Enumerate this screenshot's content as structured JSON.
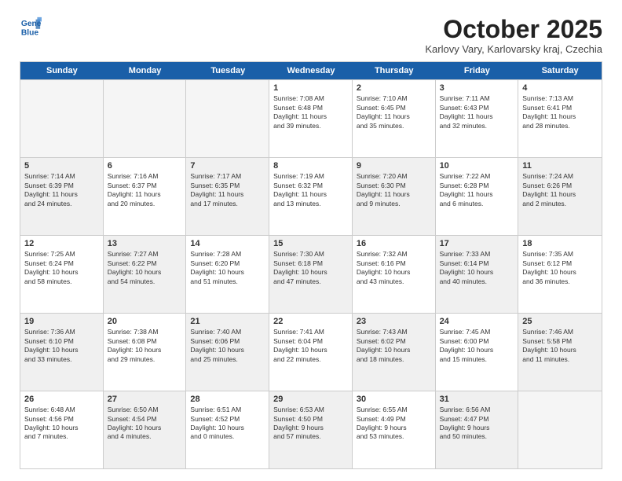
{
  "logo": {
    "line1": "General",
    "line2": "Blue"
  },
  "title": "October 2025",
  "subtitle": "Karlovy Vary, Karlovarsky kraj, Czechia",
  "header_days": [
    "Sunday",
    "Monday",
    "Tuesday",
    "Wednesday",
    "Thursday",
    "Friday",
    "Saturday"
  ],
  "rows": [
    [
      {
        "day": "",
        "text": "",
        "empty": true
      },
      {
        "day": "",
        "text": "",
        "empty": true
      },
      {
        "day": "",
        "text": "",
        "empty": true
      },
      {
        "day": "1",
        "text": "Sunrise: 7:08 AM\nSunset: 6:48 PM\nDaylight: 11 hours\nand 39 minutes."
      },
      {
        "day": "2",
        "text": "Sunrise: 7:10 AM\nSunset: 6:45 PM\nDaylight: 11 hours\nand 35 minutes."
      },
      {
        "day": "3",
        "text": "Sunrise: 7:11 AM\nSunset: 6:43 PM\nDaylight: 11 hours\nand 32 minutes."
      },
      {
        "day": "4",
        "text": "Sunrise: 7:13 AM\nSunset: 6:41 PM\nDaylight: 11 hours\nand 28 minutes."
      }
    ],
    [
      {
        "day": "5",
        "text": "Sunrise: 7:14 AM\nSunset: 6:39 PM\nDaylight: 11 hours\nand 24 minutes.",
        "shaded": true
      },
      {
        "day": "6",
        "text": "Sunrise: 7:16 AM\nSunset: 6:37 PM\nDaylight: 11 hours\nand 20 minutes."
      },
      {
        "day": "7",
        "text": "Sunrise: 7:17 AM\nSunset: 6:35 PM\nDaylight: 11 hours\nand 17 minutes.",
        "shaded": true
      },
      {
        "day": "8",
        "text": "Sunrise: 7:19 AM\nSunset: 6:32 PM\nDaylight: 11 hours\nand 13 minutes."
      },
      {
        "day": "9",
        "text": "Sunrise: 7:20 AM\nSunset: 6:30 PM\nDaylight: 11 hours\nand 9 minutes.",
        "shaded": true
      },
      {
        "day": "10",
        "text": "Sunrise: 7:22 AM\nSunset: 6:28 PM\nDaylight: 11 hours\nand 6 minutes."
      },
      {
        "day": "11",
        "text": "Sunrise: 7:24 AM\nSunset: 6:26 PM\nDaylight: 11 hours\nand 2 minutes.",
        "shaded": true
      }
    ],
    [
      {
        "day": "12",
        "text": "Sunrise: 7:25 AM\nSunset: 6:24 PM\nDaylight: 10 hours\nand 58 minutes."
      },
      {
        "day": "13",
        "text": "Sunrise: 7:27 AM\nSunset: 6:22 PM\nDaylight: 10 hours\nand 54 minutes.",
        "shaded": true
      },
      {
        "day": "14",
        "text": "Sunrise: 7:28 AM\nSunset: 6:20 PM\nDaylight: 10 hours\nand 51 minutes."
      },
      {
        "day": "15",
        "text": "Sunrise: 7:30 AM\nSunset: 6:18 PM\nDaylight: 10 hours\nand 47 minutes.",
        "shaded": true
      },
      {
        "day": "16",
        "text": "Sunrise: 7:32 AM\nSunset: 6:16 PM\nDaylight: 10 hours\nand 43 minutes."
      },
      {
        "day": "17",
        "text": "Sunrise: 7:33 AM\nSunset: 6:14 PM\nDaylight: 10 hours\nand 40 minutes.",
        "shaded": true
      },
      {
        "day": "18",
        "text": "Sunrise: 7:35 AM\nSunset: 6:12 PM\nDaylight: 10 hours\nand 36 minutes."
      }
    ],
    [
      {
        "day": "19",
        "text": "Sunrise: 7:36 AM\nSunset: 6:10 PM\nDaylight: 10 hours\nand 33 minutes.",
        "shaded": true
      },
      {
        "day": "20",
        "text": "Sunrise: 7:38 AM\nSunset: 6:08 PM\nDaylight: 10 hours\nand 29 minutes."
      },
      {
        "day": "21",
        "text": "Sunrise: 7:40 AM\nSunset: 6:06 PM\nDaylight: 10 hours\nand 25 minutes.",
        "shaded": true
      },
      {
        "day": "22",
        "text": "Sunrise: 7:41 AM\nSunset: 6:04 PM\nDaylight: 10 hours\nand 22 minutes."
      },
      {
        "day": "23",
        "text": "Sunrise: 7:43 AM\nSunset: 6:02 PM\nDaylight: 10 hours\nand 18 minutes.",
        "shaded": true
      },
      {
        "day": "24",
        "text": "Sunrise: 7:45 AM\nSunset: 6:00 PM\nDaylight: 10 hours\nand 15 minutes."
      },
      {
        "day": "25",
        "text": "Sunrise: 7:46 AM\nSunset: 5:58 PM\nDaylight: 10 hours\nand 11 minutes.",
        "shaded": true
      }
    ],
    [
      {
        "day": "26",
        "text": "Sunrise: 6:48 AM\nSunset: 4:56 PM\nDaylight: 10 hours\nand 7 minutes."
      },
      {
        "day": "27",
        "text": "Sunrise: 6:50 AM\nSunset: 4:54 PM\nDaylight: 10 hours\nand 4 minutes.",
        "shaded": true
      },
      {
        "day": "28",
        "text": "Sunrise: 6:51 AM\nSunset: 4:52 PM\nDaylight: 10 hours\nand 0 minutes."
      },
      {
        "day": "29",
        "text": "Sunrise: 6:53 AM\nSunset: 4:50 PM\nDaylight: 9 hours\nand 57 minutes.",
        "shaded": true
      },
      {
        "day": "30",
        "text": "Sunrise: 6:55 AM\nSunset: 4:49 PM\nDaylight: 9 hours\nand 53 minutes."
      },
      {
        "day": "31",
        "text": "Sunrise: 6:56 AM\nSunset: 4:47 PM\nDaylight: 9 hours\nand 50 minutes.",
        "shaded": true
      },
      {
        "day": "",
        "text": "",
        "empty": true
      }
    ]
  ]
}
